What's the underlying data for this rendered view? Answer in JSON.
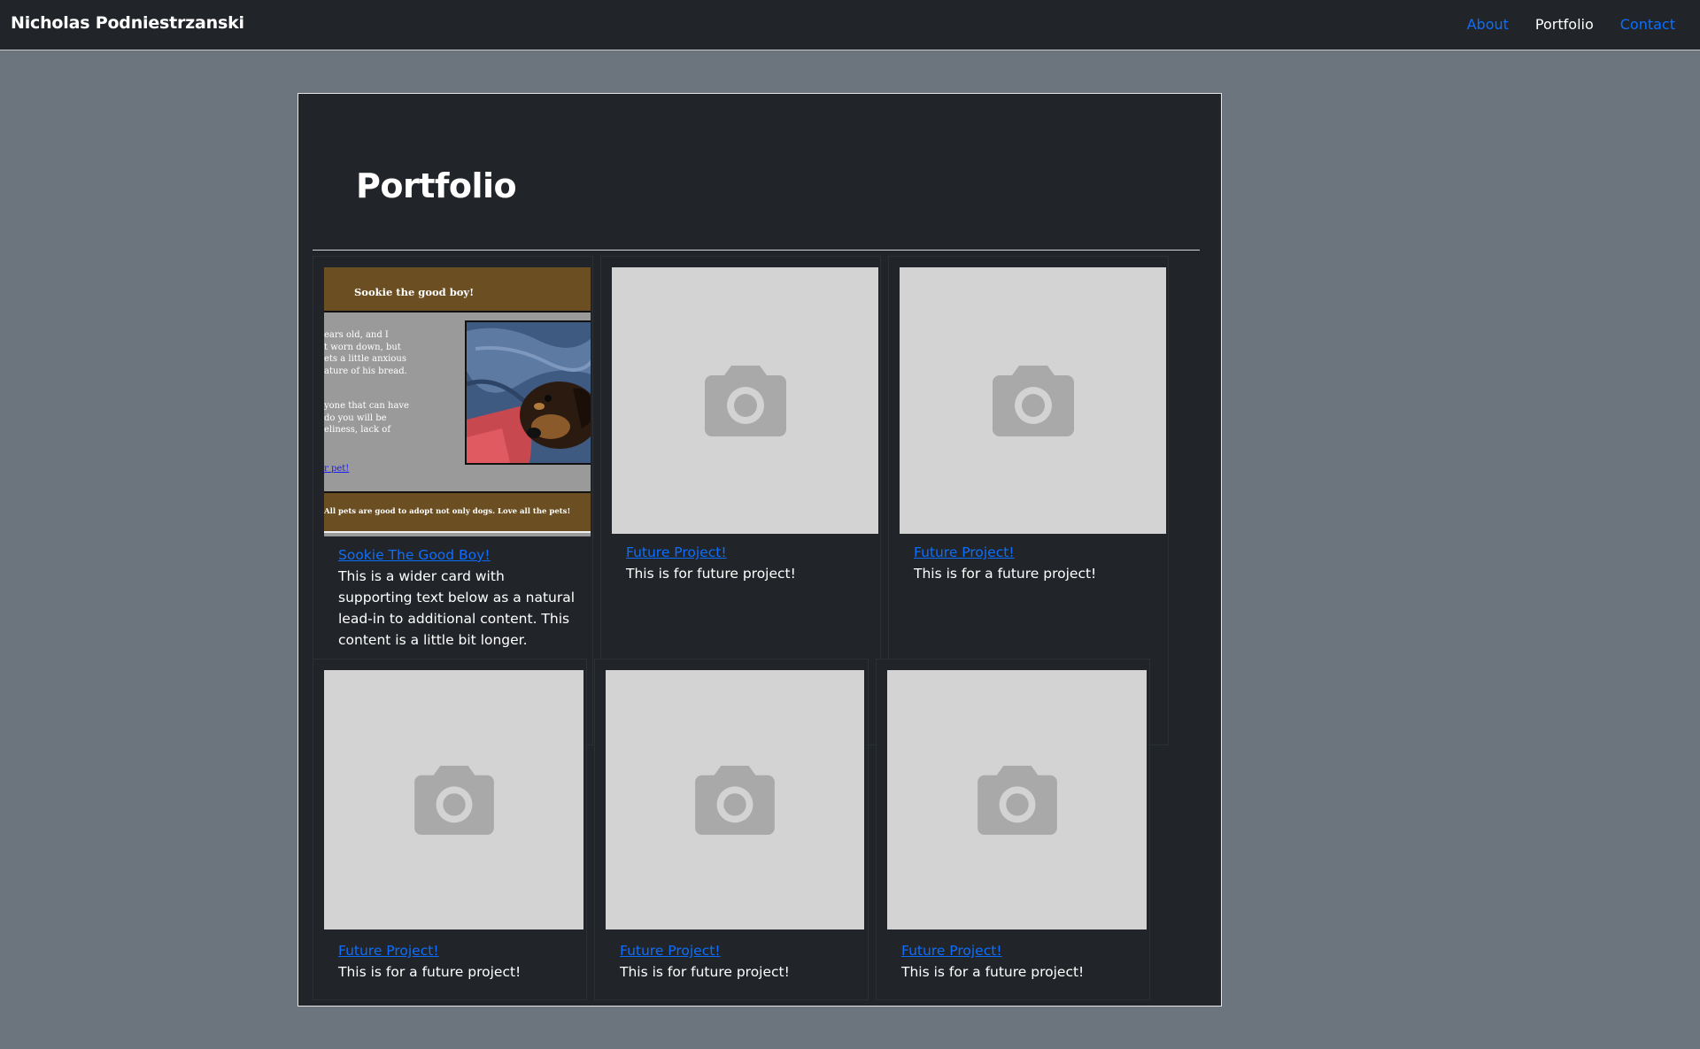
{
  "navbar": {
    "brand": "Nicholas Podniestrzanski",
    "links": [
      {
        "label": "About",
        "active": false
      },
      {
        "label": "Portfolio",
        "active": true
      },
      {
        "label": "Contact",
        "active": false
      }
    ]
  },
  "page": {
    "title": "Portfolio"
  },
  "sookie_preview": {
    "heading": "Sookie the good boy!",
    "text_a": [
      "ears old, and I",
      "t worn down, but",
      "ets a little anxious",
      "ature of his bread."
    ],
    "text_b": [
      "yone that can have",
      "do you will be",
      "eliness, lack of"
    ],
    "link": "r pet!",
    "footer": "All pets are good to adopt not only dogs. Love all the pets!"
  },
  "cards": [
    {
      "link": "Sookie The Good Boy!",
      "text": "This is a wider card with supporting text below as a natural lead-in to additional content. This content is a little bit longer.",
      "image": "sookie-preview"
    },
    {
      "link": "Future Project!",
      "text": "This is for future project!",
      "image": "camera-icon"
    },
    {
      "link": "Future Project!",
      "text": "This is for a future project!",
      "image": "camera-icon"
    },
    {
      "link": "Future Project!",
      "text": "This is for a future project!",
      "image": "camera-icon"
    },
    {
      "link": "Future Project!",
      "text": "This is for future project!",
      "image": "camera-icon"
    },
    {
      "link": "Future Project!",
      "text": "This is for a future project!",
      "image": "camera-icon"
    }
  ],
  "colors": {
    "page_background": "#6c757d",
    "navbar_background": "#212529",
    "panel_background": "#212529",
    "link": "#0d6efd",
    "placeholder_background": "#d3d3d3",
    "placeholder_icon": "#a9a9a9"
  }
}
